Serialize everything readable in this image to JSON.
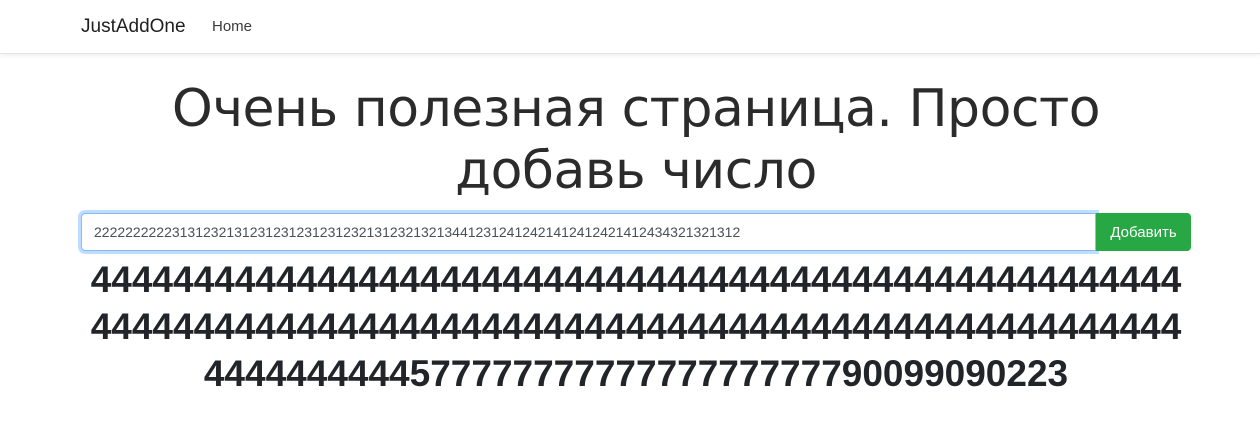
{
  "navbar": {
    "brand": "JustAddOne",
    "links": [
      {
        "label": "Home"
      }
    ]
  },
  "main": {
    "title": "Очень полезная страница. Просто добавь число",
    "input_value": "222222222231312321312312312312312321312321321344123124124214124124214124343213213 12",
    "add_button_label": "Добавить",
    "result": "444444444444444444444444444444444444444444444444444444444444444444444444444444444444444444444444444444444444444444445777777777777777777779009909 0223"
  },
  "colors": {
    "accent_green": "#28a745",
    "input_focus_border": "#80bdff"
  }
}
